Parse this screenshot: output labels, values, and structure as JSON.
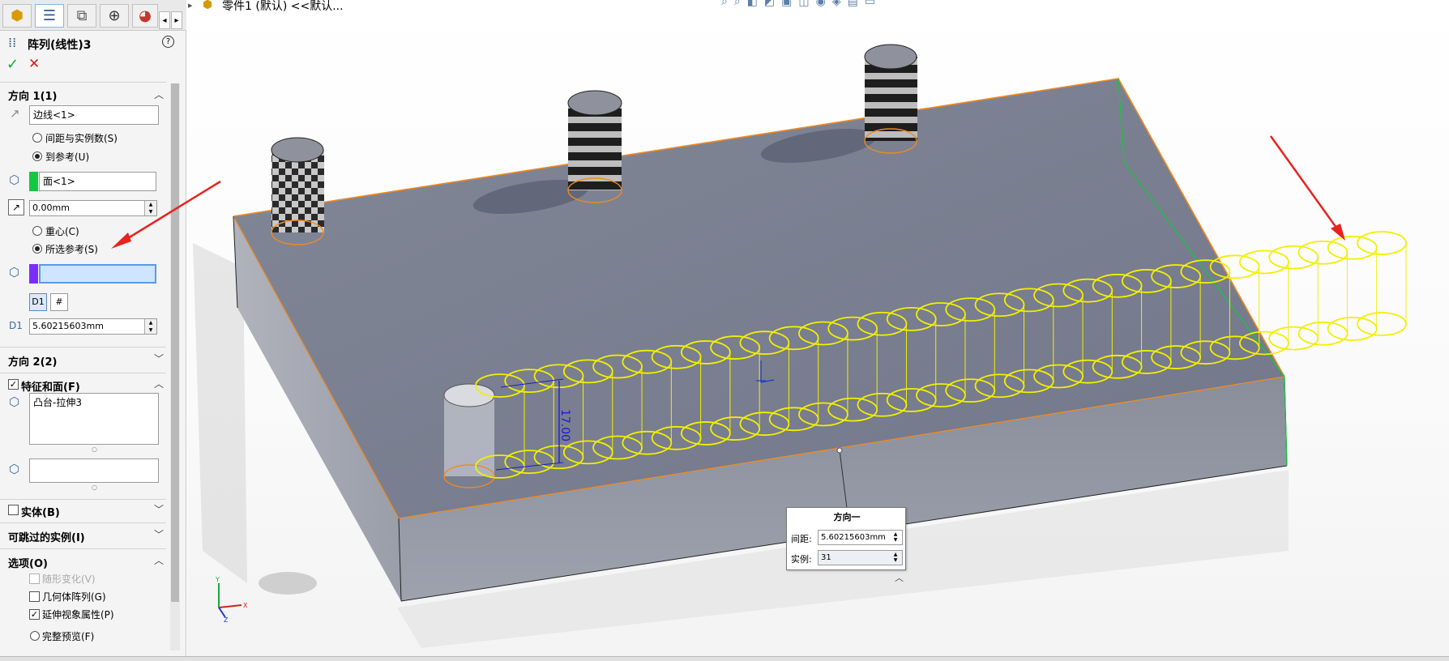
{
  "colors": {
    "accent_green": "#12c840",
    "accent_purple": "#7c2cff",
    "selection_yellow": "#f2f000",
    "edge_orange": "#f08a20",
    "arrow_red": "#e8231f",
    "body_gray": "#7c8190"
  },
  "tabs": [
    {
      "icon": "feature-manager-icon"
    },
    {
      "icon": "property-manager-icon"
    },
    {
      "icon": "configuration-manager-icon"
    },
    {
      "icon": "dimxpert-icon"
    },
    {
      "icon": "display-manager-icon"
    }
  ],
  "feature": {
    "title": "阵列(线性)3",
    "help_icon": "help-icon",
    "ok_icon": "checkmark-icon",
    "cancel_icon": "close-icon"
  },
  "direction1": {
    "header": "方向 1(1)",
    "edge_value": "边线<1>",
    "option_spacing": "间距与实例数(S)",
    "option_upto": "到参考(U)",
    "face_value": "面<1>",
    "offset_value": "0.00mm",
    "option_centroid": "重心(C)",
    "option_selected_ref": "所选参考(S)",
    "ref_value": "",
    "spacing_value": "5.60215603mm"
  },
  "direction2": {
    "header": "方向 2(2)"
  },
  "features_faces": {
    "header": "特征和面(F)",
    "checked": true,
    "features_value": "凸台-拉伸3",
    "faces_value": ""
  },
  "bodies": {
    "header": "实体(B)",
    "checked": false
  },
  "skip": {
    "header": "可跳过的实例(I)"
  },
  "options": {
    "header": "选项(O)",
    "items": [
      {
        "label": "随形变化(V)",
        "checked": false,
        "disabled": true
      },
      {
        "label": "几何体阵列(G)",
        "checked": false,
        "disabled": false
      },
      {
        "label": "延伸视象属性(P)",
        "checked": true,
        "disabled": false
      },
      {
        "label": "完整预览(F)",
        "radio": true
      }
    ]
  },
  "viewport": {
    "doc_title": "零件1 (默认) <<默认...",
    "dimension_label": "17.00"
  },
  "callout": {
    "title": "方向一",
    "spacing_label": "间距:",
    "spacing_value": "5.60215603mm",
    "instances_label": "实例:",
    "instances_value": "31"
  }
}
